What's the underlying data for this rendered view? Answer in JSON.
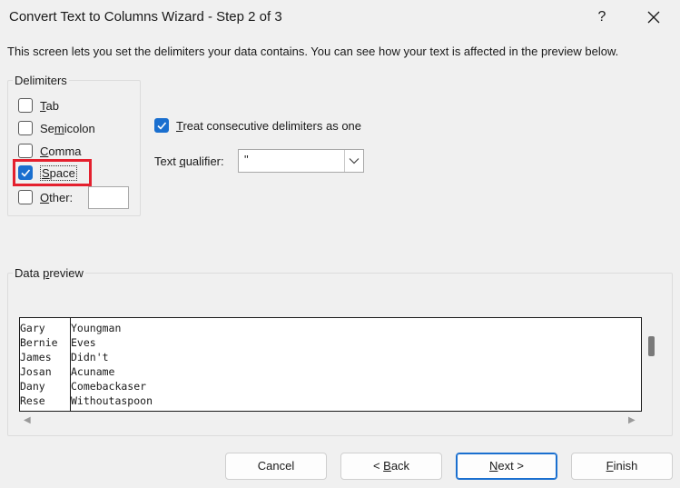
{
  "window": {
    "title": "Convert Text to Columns Wizard - Step 2 of 3",
    "help_label": "?"
  },
  "intro_text": "This screen lets you set the delimiters your data contains.  You can see how your text is affected in the preview below.",
  "delimiters": {
    "group_label": "Delimiters",
    "items": [
      {
        "pre": "",
        "acc": "T",
        "post": "ab",
        "checked": false
      },
      {
        "pre": "Se",
        "acc": "m",
        "post": "icolon",
        "checked": false
      },
      {
        "pre": "",
        "acc": "C",
        "post": "omma",
        "checked": false
      },
      {
        "pre": "",
        "acc": "S",
        "post": "pace",
        "checked": true
      },
      {
        "pre": "",
        "acc": "O",
        "post": "ther:",
        "checked": false
      }
    ],
    "other_value": ""
  },
  "consecutive": {
    "pre": "",
    "acc": "T",
    "post": "reat consecutive delimiters as one",
    "checked": true
  },
  "qualifier": {
    "label_pre": "Text ",
    "label_acc": "q",
    "label_post": "ualifier:",
    "value": "\""
  },
  "preview": {
    "group_label_pre": "Data ",
    "group_label_acc": "p",
    "group_label_post": "review",
    "rows": [
      [
        "Gary",
        "Youngman"
      ],
      [
        "Bernie",
        "Eves"
      ],
      [
        "James",
        "Didn't"
      ],
      [
        "Josan",
        "Acuname"
      ],
      [
        "Dany",
        "Comebackaser"
      ],
      [
        "Rese",
        "Withoutaspoon"
      ]
    ]
  },
  "buttons": {
    "cancel": {
      "pre": "Cancel",
      "acc": "",
      "post": ""
    },
    "back": {
      "pre": "< ",
      "acc": "B",
      "post": "ack"
    },
    "next": {
      "pre": "",
      "acc": "N",
      "post": "ext >"
    },
    "finish": {
      "pre": "",
      "acc": "F",
      "post": "inish"
    }
  },
  "colors": {
    "accent": "#1a6fcf",
    "highlight": "#e4202e"
  }
}
